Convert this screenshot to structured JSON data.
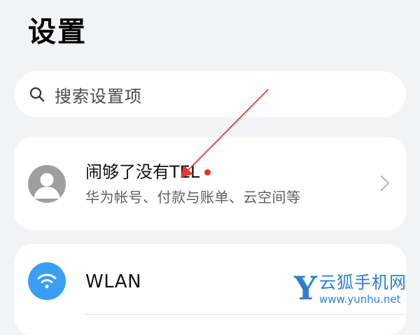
{
  "header": {
    "title": "设置"
  },
  "search": {
    "placeholder": "搜索设置项",
    "icon": "search-icon"
  },
  "account": {
    "name": "闹够了没有TEL",
    "subtitle": "华为帐号、付款与账单、云空间等",
    "has_notification_dot": true,
    "avatar_icon": "avatar-placeholder-icon",
    "chevron_icon": "chevron-right-icon"
  },
  "wlan": {
    "label": "WLAN",
    "icon": "wifi-icon"
  },
  "watermark": {
    "logo_letter": "Y",
    "brand": "云狐手机网",
    "url": "www.yunhu.net"
  },
  "colors": {
    "background": "#f1f3f5",
    "card": "#ffffff",
    "accent_blue": "#3a9ef5",
    "notification_red": "#e8332b",
    "annotation_arrow": "#e53935",
    "watermark_blue": "#2f7fd3"
  }
}
